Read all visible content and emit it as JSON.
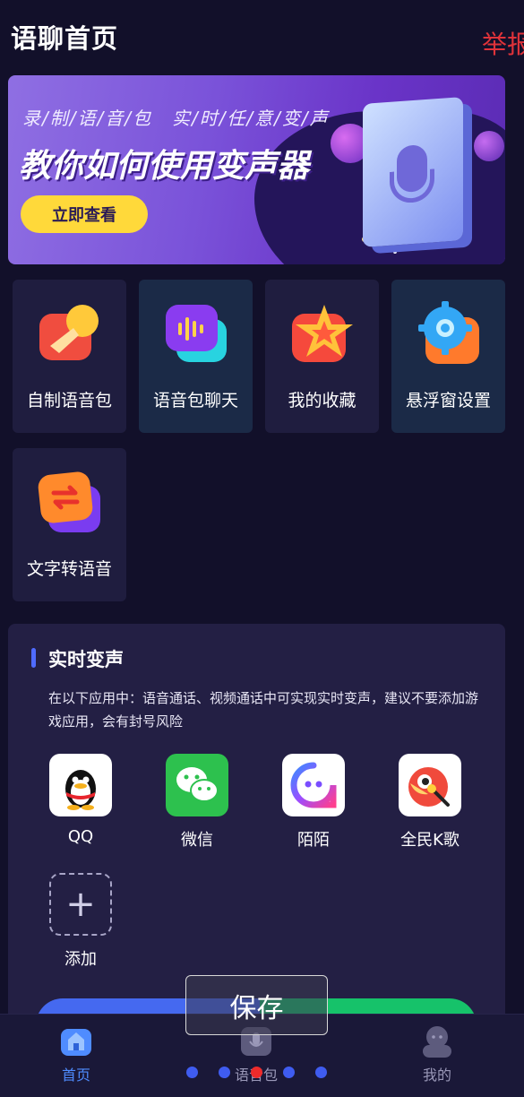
{
  "header": {
    "title": "语聊首页",
    "report": "举报"
  },
  "banner": {
    "subtitle": "录/制/语/音/包　实/时/任/意/变/声",
    "title": "教你如何使用变声器",
    "button": "立即查看"
  },
  "features": [
    {
      "label": "自制语音包",
      "icon": "mic-horn-icon",
      "color": "#f04d3f"
    },
    {
      "label": "语音包聊天",
      "icon": "voice-chat-icon",
      "color": "#8a3cf0"
    },
    {
      "label": "我的收藏",
      "icon": "star-icon",
      "color": "#ff5a3c"
    },
    {
      "label": "悬浮窗设置",
      "icon": "gear-icon",
      "color": "#33a7f5"
    },
    {
      "label": "文字转语音",
      "icon": "convert-icon",
      "color": "#ff7b2c"
    }
  ],
  "realtime": {
    "title": "实时变声",
    "description": "在以下应用中：语音通话、视频通话中可实现实时变声，建议不要添加游戏应用，会有封号风险",
    "apps": [
      {
        "name": "QQ",
        "icon": "qq-penguin-icon"
      },
      {
        "name": "微信",
        "icon": "wechat-icon"
      },
      {
        "name": "陌陌",
        "icon": "momo-icon"
      },
      {
        "name": "全民K歌",
        "icon": "karaoke-icon"
      }
    ],
    "add_label": "添加"
  },
  "nav": {
    "items": [
      {
        "label": "首页",
        "icon": "home-icon",
        "active": true
      },
      {
        "label": "语音包",
        "icon": "voice-pack-icon",
        "active": false
      },
      {
        "label": "我的",
        "icon": "profile-icon",
        "active": false
      }
    ]
  },
  "overlay": {
    "save": "保存"
  },
  "colors": {
    "accent_yellow": "#ffd93a",
    "report_red": "#e0333a",
    "nav_active": "#4f8cff",
    "nav_inactive": "#9a98b8"
  }
}
